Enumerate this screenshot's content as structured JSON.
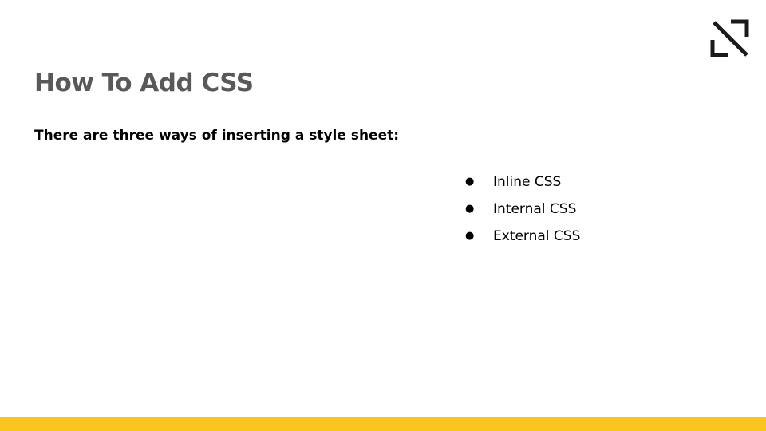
{
  "slide": {
    "title": "How To Add CSS",
    "subtitle": "There are three ways of inserting a style sheet:",
    "bullet_glyph": "●",
    "bullets": [
      {
        "label": "Inline CSS"
      },
      {
        "label": "Internal CSS"
      },
      {
        "label": "External CSS"
      }
    ]
  },
  "logo": {
    "icon": "arrow-corner-logo-icon",
    "color": "#1a1a1a"
  },
  "colors": {
    "title": "#595959",
    "text": "#000000",
    "accent_bar": "#FBC520",
    "background": "#ffffff"
  }
}
